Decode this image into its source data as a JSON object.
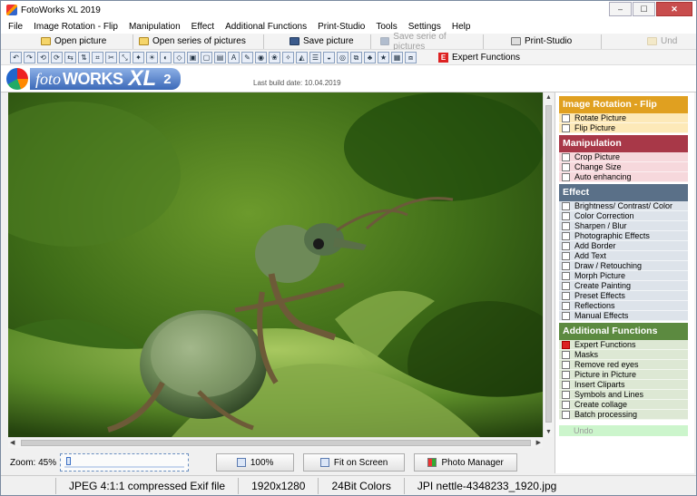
{
  "window": {
    "title": "FotoWorks XL 2019",
    "btn_min": "–",
    "btn_max": "☐",
    "btn_close": "✕"
  },
  "menu": [
    "File",
    "Image Rotation - Flip",
    "Manipulation",
    "Effect",
    "Additional Functions",
    "Print-Studio",
    "Tools",
    "Settings",
    "Help"
  ],
  "toolbar": {
    "open_picture": "Open picture",
    "open_series": "Open series of pictures",
    "save_picture": "Save picture",
    "save_series": "Save serie of pictures",
    "print_studio": "Print-Studio",
    "undo": "Und",
    "expert_functions": "Expert Functions"
  },
  "banner": {
    "foto": "foto",
    "works": "WORKS",
    "xl": "XL",
    "version": "2",
    "build_date": "Last build date: 10.04.2019"
  },
  "zoom": {
    "label": "Zoom: 45%",
    "value_percent": 45
  },
  "buttons": {
    "zoom100": "100%",
    "fit_on_screen": "Fit on Screen",
    "photo_manager": "Photo Manager"
  },
  "status": [
    "JPEG 4:1:1 compressed Exif file",
    "1920x1280",
    "24Bit Colors",
    "JPI nettle-4348233_1920.jpg"
  ],
  "panel": {
    "sections": [
      {
        "title": "Image Rotation - Flip",
        "color": "#e0a020",
        "item_bg": "#fde9b8",
        "items": [
          "Rotate Picture",
          "Flip Picture"
        ]
      },
      {
        "title": "Manipulation",
        "color": "#a83848",
        "item_bg": "#f6d8dc",
        "items": [
          "Crop Picture",
          "Change Size",
          "Auto enhancing"
        ]
      },
      {
        "title": "Effect",
        "color": "#5a7088",
        "item_bg": "#dde3ea",
        "items": [
          "Brightness/ Contrast/ Color",
          "Color Correction",
          "Sharpen / Blur",
          "Photographic Effects",
          "Add Border",
          "Add Text",
          "Draw / Retouching",
          "Morph Picture",
          "Create Painting",
          "Preset Effects",
          "Reflections",
          "Manual Effects"
        ]
      },
      {
        "title": "Additional Functions",
        "color": "#5c8a40",
        "item_bg": "#dde8d4",
        "items": [
          "Expert Functions",
          "Masks",
          "Remove red eyes",
          "Picture in Picture",
          "Insert Cliparts",
          "Symbols and Lines",
          "Create collage",
          "Batch processing"
        ]
      }
    ],
    "undo": "Undo"
  }
}
